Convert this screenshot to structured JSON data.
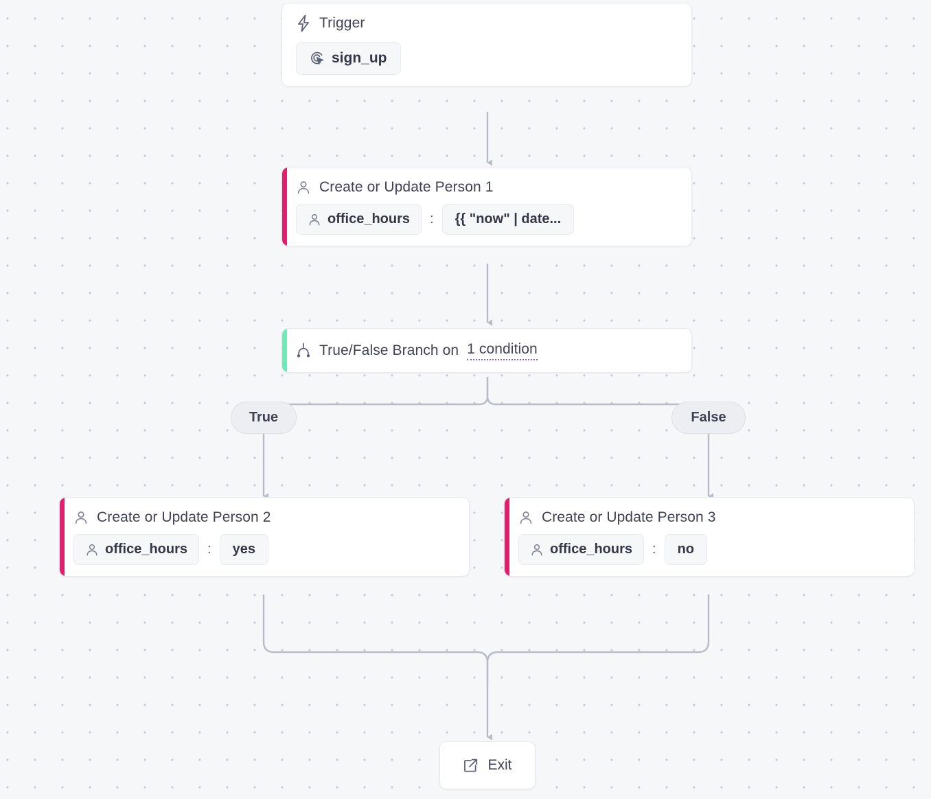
{
  "canvas": {
    "background": "#f6f7f9",
    "dot_color": "#c9cad6",
    "edge_color": "#b9bbc9"
  },
  "nodes": {
    "trigger": {
      "title": "Trigger",
      "title_icon": "lightning-bolt-icon",
      "event_label": "sign_up",
      "event_icon": "click-target-icon"
    },
    "person1": {
      "title": "Create or Update Person 1",
      "title_icon": "person-icon",
      "accent_color": "#e0206a",
      "field_key": "office_hours",
      "field_key_icon": "person-icon",
      "field_value": "{{ \"now\" | date..."
    },
    "branch": {
      "title_prefix": "True/False Branch on",
      "title_link": "1 condition",
      "title_icon": "branch-split-icon",
      "accent_color": "#6fe9b6",
      "link_underline_color": "#7c5cd6"
    },
    "person2": {
      "title": "Create or Update Person 2",
      "title_icon": "person-icon",
      "accent_color": "#e0206a",
      "field_key": "office_hours",
      "field_key_icon": "person-icon",
      "field_value": "yes"
    },
    "person3": {
      "title": "Create or Update Person 3",
      "title_icon": "person-icon",
      "accent_color": "#e0206a",
      "field_key": "office_hours",
      "field_key_icon": "person-icon",
      "field_value": "no"
    },
    "exit": {
      "label": "Exit",
      "icon": "external-link-icon"
    }
  },
  "branch_labels": {
    "true": "True",
    "false": "False"
  }
}
